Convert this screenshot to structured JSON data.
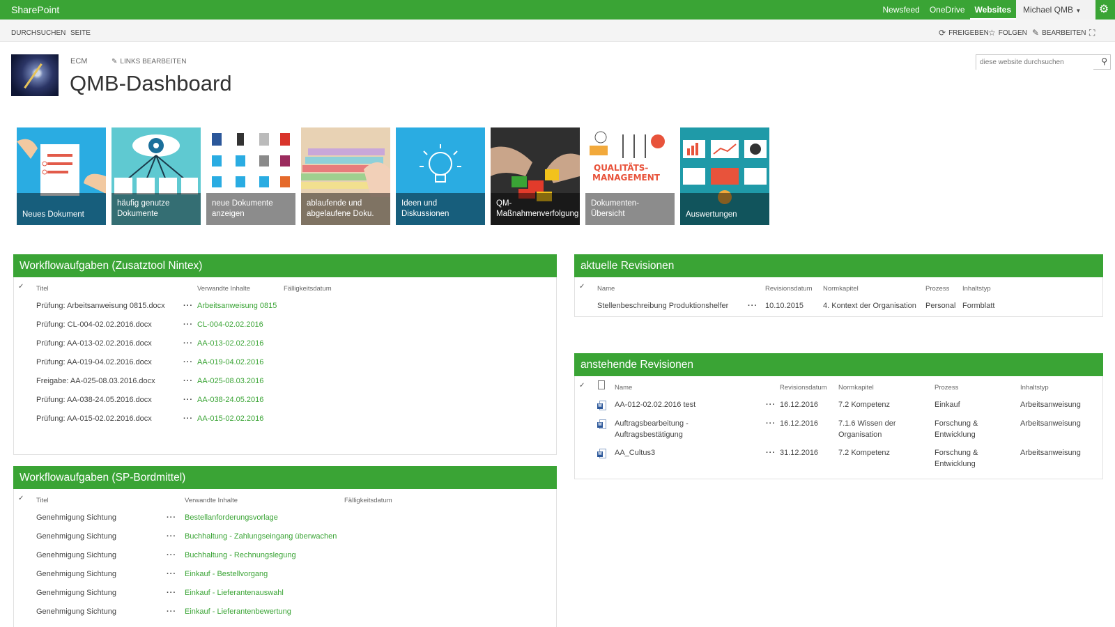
{
  "suitebar": {
    "brand": "SharePoint",
    "links": [
      "Newsfeed",
      "OneDrive",
      "Websites"
    ],
    "user": "Michael QMB"
  },
  "ribbon": {
    "tabs": [
      "DURCHSUCHEN",
      "SEITE"
    ],
    "share": "FREIGEBEN",
    "follow": "FOLGEN",
    "edit": "BEARBEITEN"
  },
  "site": {
    "breadcrumb": "ECM",
    "edit_links": "LINKS BEARBEITEN",
    "title": "QMB-Dashboard",
    "search_placeholder": "diese website durchsuchen"
  },
  "tiles": [
    {
      "label": "Neues Dokument",
      "color": "#2aace2"
    },
    {
      "label": "häufig genutze Dokumente",
      "color": "#5fc9d1"
    },
    {
      "label": "neue Dokumente anzeigen",
      "color": "#ffffff"
    },
    {
      "label": "ablaufende und abgelaufene Doku.",
      "color": "#d9b892"
    },
    {
      "label": "Ideen und Diskussionen",
      "color": "#2aace2"
    },
    {
      "label": "QM-Maßnahmenverfolgung",
      "color": "#3b3b3b"
    },
    {
      "label": "Dokumenten-Übersicht",
      "color": "#ffffff"
    },
    {
      "label": "Auswertungen",
      "color": "#1f9aa8"
    }
  ],
  "wf_nintex": {
    "title": "Workflowaufgaben (Zusatztool Nintex)",
    "headers": [
      "Titel",
      "Verwandte Inhalte",
      "Fälligkeitsdatum"
    ],
    "rows": [
      {
        "title": "Prüfung: Arbeitsanweisung 0815.docx",
        "related": "Arbeitsanweisung 0815"
      },
      {
        "title": "Prüfung: CL-004-02.02.2016.docx",
        "related": "CL-004-02.02.2016"
      },
      {
        "title": "Prüfung: AA-013-02.02.2016.docx",
        "related": "AA-013-02.02.2016"
      },
      {
        "title": "Prüfung: AA-019-04.02.2016.docx",
        "related": "AA-019-04.02.2016"
      },
      {
        "title": "Freigabe: AA-025-08.03.2016.docx",
        "related": "AA-025-08.03.2016"
      },
      {
        "title": "Prüfung: AA-038-24.05.2016.docx",
        "related": "AA-038-24.05.2016"
      },
      {
        "title": "Prüfung: AA-015-02.02.2016.docx",
        "related": "AA-015-02.02.2016"
      }
    ]
  },
  "wf_sp": {
    "title": "Workflowaufgaben (SP-Bordmittel)",
    "headers": [
      "Titel",
      "Verwandte Inhalte",
      "Fälligkeitsdatum"
    ],
    "rows": [
      {
        "title": "Genehmigung Sichtung",
        "related": "Bestellanforderungsvorlage"
      },
      {
        "title": "Genehmigung Sichtung",
        "related": "Buchhaltung - Zahlungseingang überwachen"
      },
      {
        "title": "Genehmigung Sichtung",
        "related": "Buchhaltung - Rechnungslegung"
      },
      {
        "title": "Genehmigung Sichtung",
        "related": "Einkauf - Bestellvorgang"
      },
      {
        "title": "Genehmigung Sichtung",
        "related": "Einkauf - Lieferantenauswahl"
      },
      {
        "title": "Genehmigung Sichtung",
        "related": "Einkauf - Lieferantenbewertung"
      }
    ]
  },
  "current_rev": {
    "title": "aktuelle Revisionen",
    "headers": [
      "Name",
      "Revisionsdatum",
      "Normkapitel",
      "Prozess",
      "Inhaltstyp"
    ],
    "rows": [
      {
        "name": "Stellenbeschreibung Produktionshelfer",
        "date": "10.10.2015",
        "chapter": "4. Kontext der Organisation",
        "process": "Personal",
        "type": "Formblatt"
      }
    ]
  },
  "pending_rev": {
    "title": "anstehende Revisionen",
    "headers": [
      "Name",
      "Revisionsdatum",
      "Normkapitel",
      "Prozess",
      "Inhaltstyp"
    ],
    "rows": [
      {
        "name1": "AA-012-02.02.2016 test",
        "name2": "",
        "date": "16.12.2016",
        "chapter1": "7.2 Kompetenz",
        "chapter2": "",
        "process1": "Einkauf",
        "process2": "",
        "type": "Arbeitsanweisung"
      },
      {
        "name1": "Auftragsbearbeitung -",
        "name2": "Auftragsbestätigung",
        "date": "16.12.2016",
        "chapter1": "7.1.6 Wissen der",
        "chapter2": "Organisation",
        "process1": "Forschung &",
        "process2": "Entwicklung",
        "type": "Arbeitsanweisung"
      },
      {
        "name1": "AA_Cultus3",
        "name2": "",
        "date": "31.12.2016",
        "chapter1": "7.2 Kompetenz",
        "chapter2": "",
        "process1": "Forschung &",
        "process2": "Entwicklung",
        "type": "Arbeitsanweisung"
      }
    ]
  }
}
